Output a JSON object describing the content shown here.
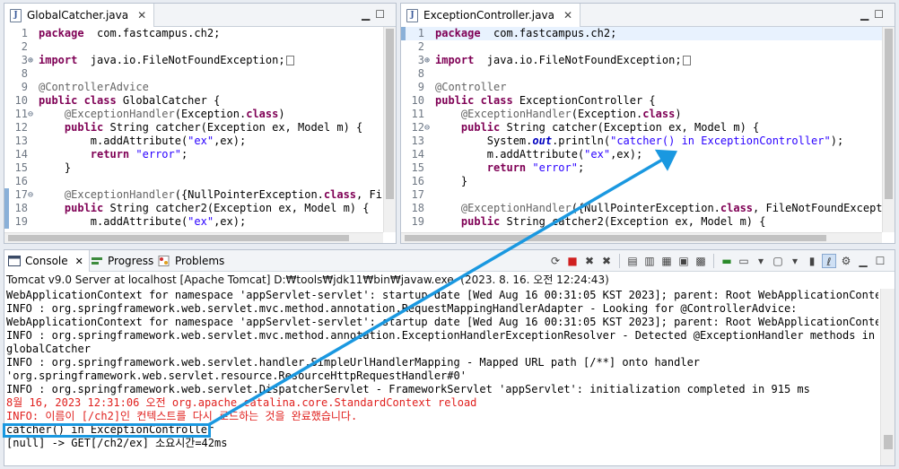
{
  "left_editor": {
    "tab_label": "GlobalCatcher.java",
    "file_icon": "J",
    "lines": [
      {
        "num": "1",
        "text": [
          [
            "kw",
            "package"
          ],
          [
            "",
            "  com.fastcampus.ch2;"
          ]
        ]
      },
      {
        "num": "2",
        "text": []
      },
      {
        "num": "3",
        "fold": "⊕",
        "text": [
          [
            "kw",
            "import"
          ],
          [
            "",
            "  java.io.FileNotFoundException;"
          ]
        ],
        "dots": true
      },
      {
        "num": "8",
        "text": []
      },
      {
        "num": "9",
        "text": [
          [
            "an",
            "@ControllerAdvice"
          ]
        ]
      },
      {
        "num": "10",
        "text": [
          [
            "kw",
            "public class"
          ],
          [
            "",
            " GlobalCatcher {"
          ]
        ]
      },
      {
        "num": "11",
        "fold": "⊖",
        "text": [
          [
            "",
            "    "
          ],
          [
            "an",
            "@ExceptionHandler"
          ],
          [
            "",
            "(Exception."
          ],
          [
            "kw",
            "class"
          ],
          [
            "",
            ")"
          ]
        ]
      },
      {
        "num": "12",
        "text": [
          [
            "",
            "    "
          ],
          [
            "kw",
            "public"
          ],
          [
            "",
            " String catcher(Exception ex, Model m) {"
          ]
        ]
      },
      {
        "num": "13",
        "text": [
          [
            "",
            "        m.addAttribute("
          ],
          [
            "str",
            "\"ex\""
          ],
          [
            "",
            ",ex);"
          ]
        ]
      },
      {
        "num": "14",
        "text": [
          [
            "",
            "        "
          ],
          [
            "kw",
            "return"
          ],
          [
            "",
            " "
          ],
          [
            "str",
            "\"error\""
          ],
          [
            "",
            ";"
          ]
        ]
      },
      {
        "num": "15",
        "text": [
          [
            "",
            "    }"
          ]
        ]
      },
      {
        "num": "16",
        "text": []
      },
      {
        "num": "17",
        "fold": "⊖",
        "marker": true,
        "text": [
          [
            "",
            "    "
          ],
          [
            "an",
            "@ExceptionHandler"
          ],
          [
            "",
            "({NullPointerException."
          ],
          [
            "kw",
            "class"
          ],
          [
            "",
            ", Fi"
          ]
        ]
      },
      {
        "num": "18",
        "marker": true,
        "text": [
          [
            "",
            "    "
          ],
          [
            "kw",
            "public"
          ],
          [
            "",
            " String catcher2(Exception ex, Model m) {"
          ]
        ]
      },
      {
        "num": "19",
        "marker": true,
        "text": [
          [
            "",
            "        m.addAttribute("
          ],
          [
            "str",
            "\"ex\""
          ],
          [
            "",
            ",ex);"
          ]
        ]
      }
    ]
  },
  "right_editor": {
    "tab_label": "ExceptionController.java",
    "file_icon": "J",
    "lines": [
      {
        "num": "1",
        "marker": true,
        "highlight": true,
        "text": [
          [
            "kw",
            "package"
          ],
          [
            "",
            "  com.fastcampus.ch2;"
          ]
        ]
      },
      {
        "num": "2",
        "text": []
      },
      {
        "num": "3",
        "fold": "⊕",
        "text": [
          [
            "kw",
            "import"
          ],
          [
            "",
            "  java.io.FileNotFoundException;"
          ]
        ],
        "dots": true
      },
      {
        "num": "8",
        "text": []
      },
      {
        "num": "9",
        "text": [
          [
            "an",
            "@Controller"
          ]
        ]
      },
      {
        "num": "10",
        "text": [
          [
            "kw",
            "public class"
          ],
          [
            "",
            " ExceptionController {"
          ]
        ]
      },
      {
        "num": "11",
        "text": [
          [
            "",
            "    "
          ],
          [
            "an",
            "@ExceptionHandler"
          ],
          [
            "",
            "(Exception."
          ],
          [
            "kw",
            "class"
          ],
          [
            "",
            ")"
          ]
        ]
      },
      {
        "num": "12",
        "fold": "⊖",
        "text": [
          [
            "",
            "    "
          ],
          [
            "kw",
            "public"
          ],
          [
            "",
            " String catcher(Exception ex, Model m) {"
          ]
        ]
      },
      {
        "num": "13",
        "text": [
          [
            "",
            "        System."
          ],
          [
            "fld",
            "out"
          ],
          [
            "",
            ".println("
          ],
          [
            "str",
            "\"catcher() in ExceptionController\""
          ],
          [
            "",
            ");"
          ]
        ]
      },
      {
        "num": "14",
        "text": [
          [
            "",
            "        m.addAttribute("
          ],
          [
            "str",
            "\"ex\""
          ],
          [
            "",
            ",ex);"
          ]
        ]
      },
      {
        "num": "15",
        "text": [
          [
            "",
            "        "
          ],
          [
            "kw",
            "return"
          ],
          [
            "",
            " "
          ],
          [
            "str",
            "\"error\""
          ],
          [
            "",
            ";"
          ]
        ]
      },
      {
        "num": "16",
        "text": [
          [
            "",
            "    }"
          ]
        ]
      },
      {
        "num": "17",
        "text": []
      },
      {
        "num": "18",
        "text": [
          [
            "",
            "    "
          ],
          [
            "an",
            "@ExceptionHandler"
          ],
          [
            "",
            "({NullPointerException."
          ],
          [
            "kw",
            "class"
          ],
          [
            "",
            ", FileNotFoundExcept"
          ]
        ]
      },
      {
        "num": "19",
        "text": [
          [
            "",
            "    "
          ],
          [
            "kw",
            "public"
          ],
          [
            "",
            " String catcher2(Exception ex, Model m) {"
          ]
        ]
      }
    ]
  },
  "console": {
    "tabs": [
      {
        "label": "Console",
        "icon": "console-icon",
        "active": true,
        "close": "✕"
      },
      {
        "label": "Progress",
        "icon": "progress-icon"
      },
      {
        "label": "Problems",
        "icon": "problems-icon"
      }
    ],
    "process_line": "Tomcat v9.0 Server at localhost [Apache Tomcat] D:₩tools₩jdk11₩bin₩javaw.exe  (2023. 8. 16. 오전 12:24:43)",
    "lines": [
      {
        "text": "WebApplicationContext for namespace 'appServlet-servlet': startup date [Wed Aug 16 00:31:05 KST 2023]; parent: Root WebApplicationContext"
      },
      {
        "text": "INFO : org.springframework.web.servlet.mvc.method.annotation.RequestMappingHandlerAdapter - Looking for @ControllerAdvice:"
      },
      {
        "text": "WebApplicationContext for namespace 'appServlet-servlet': startup date [Wed Aug 16 00:31:05 KST 2023]; parent: Root WebApplicationContext"
      },
      {
        "text": "INFO : org.springframework.web.servlet.mvc.method.annotation.ExceptionHandlerExceptionResolver - Detected @ExceptionHandler methods in"
      },
      {
        "text": "globalCatcher"
      },
      {
        "text": "INFO : org.springframework.web.servlet.handler.SimpleUrlHandlerMapping - Mapped URL path [/**] onto handler"
      },
      {
        "text": "'org.springframework.web.servlet.resource.ResourceHttpRequestHandler#0'"
      },
      {
        "text": "INFO : org.springframework.web.servlet.DispatcherServlet - FrameworkServlet 'appServlet': initialization completed in 915 ms"
      },
      {
        "text": "8월 16, 2023 12:31:06 오전 org.apache.catalina.core.StandardContext reload",
        "red": true
      },
      {
        "text": "INFO: 이름이 [/ch2]인 컨텍스트를 다시 로드하는 것을 완료했습니다.",
        "red": true
      },
      {
        "text": "catcher() in ExceptionController"
      },
      {
        "text": "[null] -> GET[/ch2/ex] 소요시간=42ms"
      }
    ]
  },
  "annotation": {
    "box_color": "#1a98e0",
    "arrow_color": "#1a98e0"
  }
}
